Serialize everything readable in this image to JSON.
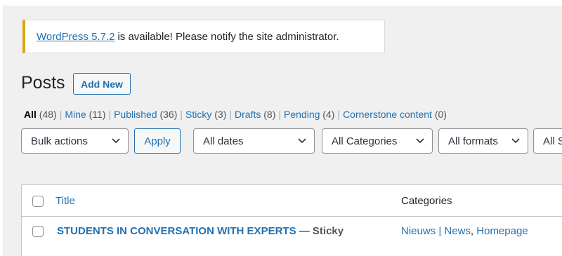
{
  "notice": {
    "link_text": "WordPress 5.7.2",
    "message": "is available! Please notify the site administrator."
  },
  "header": {
    "title": "Posts",
    "add_new_label": "Add New"
  },
  "views": [
    {
      "label": "All",
      "count": "(48)",
      "current": true
    },
    {
      "label": "Mine",
      "count": "(11)"
    },
    {
      "label": "Published",
      "count": "(36)"
    },
    {
      "label": "Sticky",
      "count": "(3)"
    },
    {
      "label": "Drafts",
      "count": "(8)"
    },
    {
      "label": "Pending",
      "count": "(4)"
    },
    {
      "label": "Cornerstone content",
      "count": "(0)"
    }
  ],
  "separator": "|",
  "filters": {
    "bulk_actions": "Bulk actions",
    "apply_label": "Apply",
    "dates": "All dates",
    "categories": "All Categories",
    "formats": "All formats",
    "partial": "All S"
  },
  "table": {
    "col_title": "Title",
    "col_categories": "Categories",
    "rows": [
      {
        "title": "STUDENTS IN CONVERSATION WITH EXPERTS",
        "state": "— Sticky",
        "categories": [
          "Nieuws | News",
          "Homepage"
        ],
        "cat_sep": ", "
      }
    ]
  },
  "colors": {
    "accent": "#2271b1",
    "notice_warning": "#dba617",
    "background": "#f0f0f1"
  }
}
